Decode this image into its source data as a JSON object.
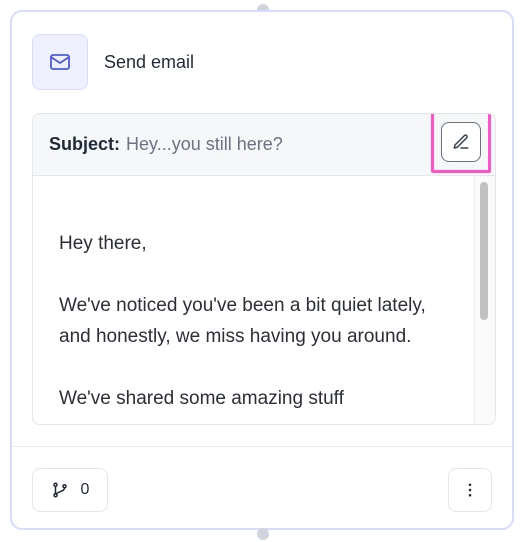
{
  "node": {
    "title": "Send email",
    "icon": "mail-icon"
  },
  "email": {
    "subject_label": "Subject:",
    "subject_value": "Hey...you still here?",
    "edit_icon": "edit-icon",
    "body": [
      "Hey there,",
      "We've noticed you've been a bit quiet lately, and honestly, we miss having you around.",
      "We've shared some amazing stuff"
    ]
  },
  "footer": {
    "branch_icon": "git-branch-icon",
    "branch_count": "0",
    "more_icon": "more-vertical-icon"
  },
  "colors": {
    "accent": "#4f5bd5",
    "highlight": "#ff52c8",
    "card_border": "#d6dcff"
  }
}
